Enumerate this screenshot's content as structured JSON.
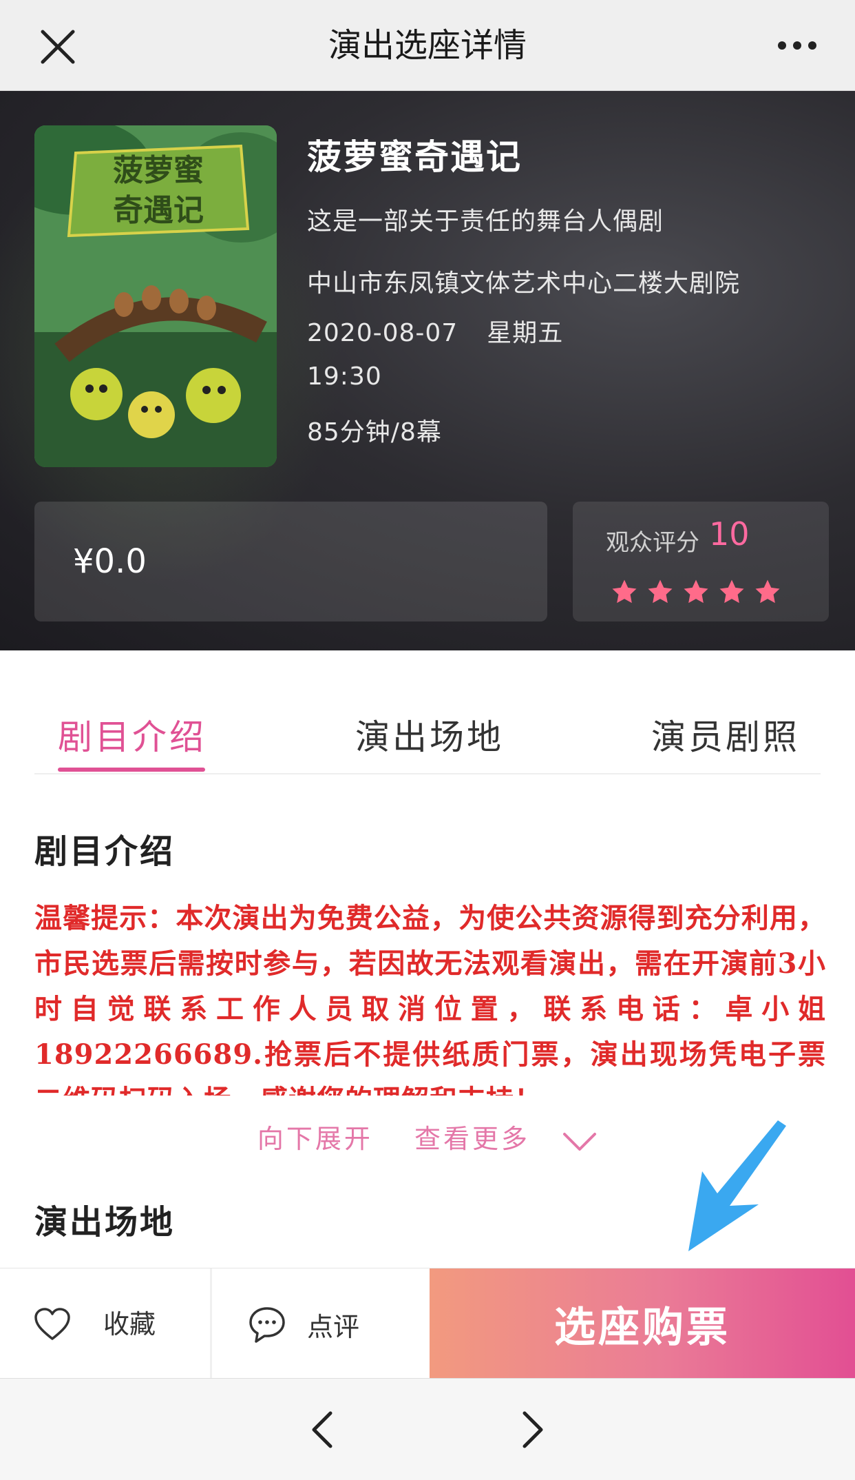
{
  "topbar": {
    "title": "演出选座详情",
    "close_icon": "close-icon",
    "more_icon": "more-dots-icon"
  },
  "show": {
    "title": "菠萝蜜奇遇记",
    "subtitle": "这是一部关于责任的舞台人偶剧",
    "venue": "中山市东凤镇文体艺术中心二楼大剧院",
    "date": "2020-08-07",
    "weekday": "星期五",
    "time": "19:30",
    "duration": "85分钟/8幕",
    "poster_title_line1": "菠萝蜜",
    "poster_title_line2": "奇遇记"
  },
  "price": {
    "text": "¥0.0"
  },
  "rating": {
    "label": "观众评分",
    "score": "10",
    "stars_filled": 5,
    "stars_total": 5,
    "star_color": "#ff6b8a"
  },
  "tabs": [
    {
      "label": "剧目介绍",
      "active": true
    },
    {
      "label": "演出场地",
      "active": false
    },
    {
      "label": "演员剧照",
      "active": false
    }
  ],
  "intro": {
    "heading": "剧目介绍",
    "notice": "温馨提示：本次演出为免费公益，为使公共资源得到充分利用，市民选票后需按时参与，若因故无法观看演出，需在开演前3小时自觉联系工作人员取消位置，联系电话：卓小姐18922266689.抢票后不提供纸质门票，演出现场凭电子票二维码扫码入场，感谢您的理解和支持！",
    "expand_label_1": "向下展开",
    "expand_label_2": "查看更多"
  },
  "venue_section": {
    "heading": "演出场地"
  },
  "actions": {
    "favorite_label": "收藏",
    "review_label": "点评",
    "buy_label": "选座购票"
  },
  "colors": {
    "accent": "#e05194",
    "notice_red": "#e02a2a",
    "buy_gradient_start": "#f29a7f",
    "buy_gradient_end": "#e24f93",
    "hint_arrow": "#3aa8f0"
  }
}
